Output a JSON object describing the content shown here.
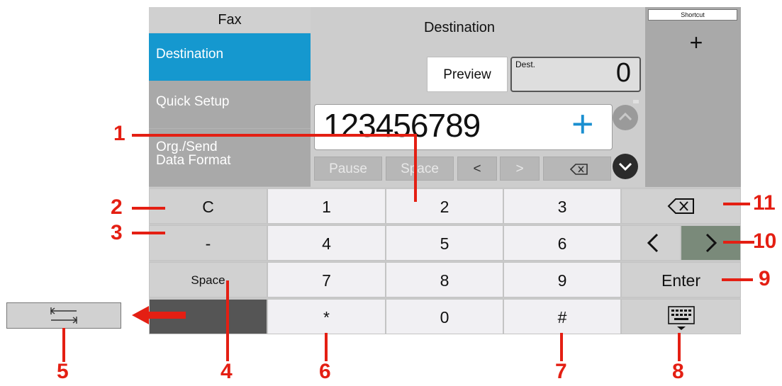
{
  "sidebar": {
    "title": "Fax",
    "items": [
      {
        "label": "Destination"
      },
      {
        "label": "Quick Setup"
      },
      {
        "label": "Org./Send\nData Format"
      }
    ]
  },
  "destination": {
    "title": "Destination",
    "preview_label": "Preview",
    "dest_label": "Dest.",
    "dest_count": "0",
    "number_value": "123456789",
    "add_icon": "+",
    "buttons": {
      "pause": "Pause",
      "space": "Space",
      "left": "<",
      "right": ">",
      "backspace": "⌫"
    }
  },
  "shortcut": {
    "label": "Shortcut",
    "add": "+"
  },
  "keypad": {
    "rows": [
      [
        "C",
        "1",
        "2",
        "3",
        "backspace"
      ],
      [
        "-",
        "4",
        "5",
        "6",
        "arrows"
      ],
      [
        "Space",
        "7",
        "8",
        "9",
        "Enter"
      ],
      [
        "",
        "*",
        "0",
        "#",
        "keyboard"
      ]
    ],
    "keys": {
      "c": "C",
      "dash": "-",
      "space": "Space",
      "n1": "1",
      "n2": "2",
      "n3": "3",
      "n4": "4",
      "n5": "5",
      "n6": "6",
      "n7": "7",
      "n8": "8",
      "n9": "9",
      "star": "*",
      "n0": "0",
      "hash": "#",
      "enter": "Enter"
    }
  },
  "callouts": [
    "1",
    "2",
    "3",
    "4",
    "5",
    "6",
    "7",
    "8",
    "9",
    "10",
    "11"
  ],
  "colors": {
    "accent": "#1598cf",
    "callout": "#e41f13",
    "plus": "#1a8fd0"
  }
}
